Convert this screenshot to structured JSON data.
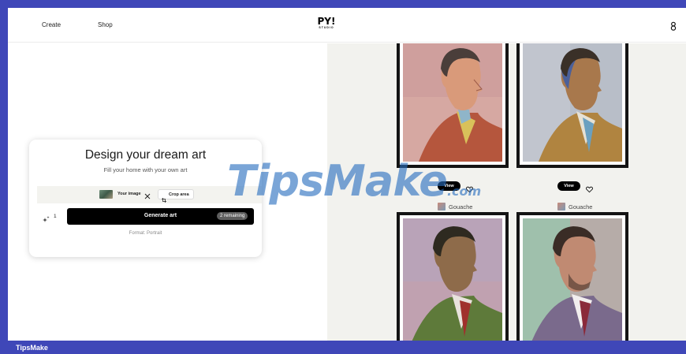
{
  "nav": {
    "create": "Create",
    "shop": "Shop",
    "logo_main": "PY!",
    "logo_sub": "STUDIO",
    "account_icon": "user-icon"
  },
  "card": {
    "title": "Design your dream art",
    "subtitle": "Fill your home with your own art",
    "your_image": "Your image",
    "crop_area": "Crop area",
    "quantity": "1",
    "generate": "Generate art",
    "remaining": "2 remaining",
    "format": "Format: Portrait"
  },
  "gallery": {
    "view_label": "View",
    "items": [
      {
        "style": "Gouache",
        "has_view": false
      },
      {
        "style": "Gouache",
        "has_view": false
      },
      {
        "style": "Gouache",
        "has_view": true
      },
      {
        "style": "Gouache",
        "has_view": true
      }
    ]
  },
  "watermark": {
    "text": "TipsMake",
    "suffix": ".com"
  },
  "footer": {
    "brand": "TipsMake"
  },
  "colors": {
    "frame": "#3f47b8",
    "gallery_bg": "#f2f2ee",
    "button": "#000000"
  }
}
